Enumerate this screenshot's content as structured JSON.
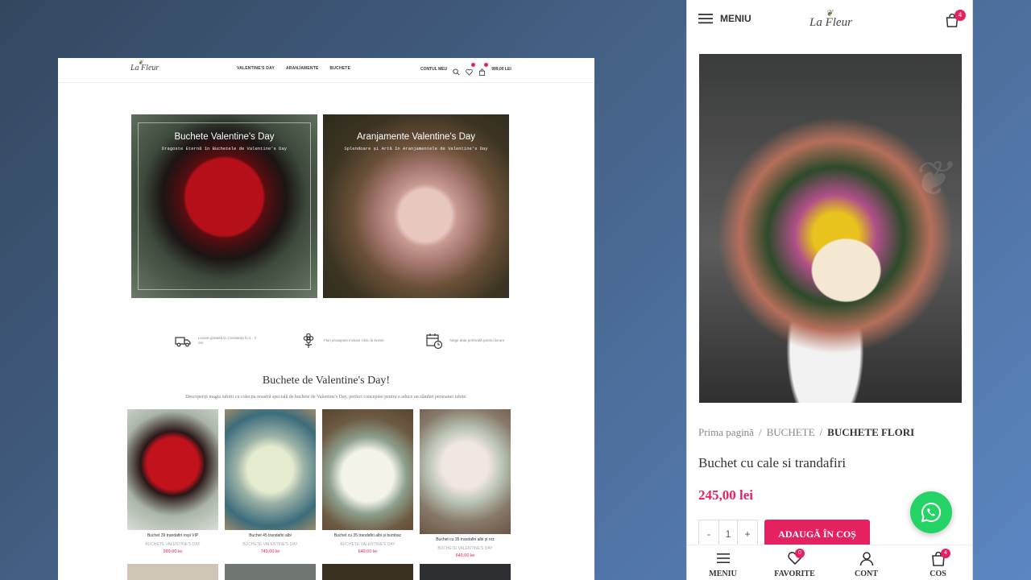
{
  "desktop": {
    "logo": "La Fleur",
    "nav": [
      "VALENTINE'S DAY",
      "ARANJAMENTE",
      "BUCHETE"
    ],
    "account": "CONTUL MEU",
    "wishlist_count": "",
    "cart_amount": "999,00 LEI",
    "banners": [
      {
        "title": "Buchete Valentine's Day",
        "subtitle": "Dragoste Eternă în Buchetele de Valentine's Day"
      },
      {
        "title": "Aranjamente Valentine's Day",
        "subtitle": "Splendoare și Artă în Aranjamentele de Valentine's Day"
      }
    ],
    "features": [
      {
        "icon": "delivery-truck-icon",
        "text": "Livrare gratuită în Constanța în 2 - 4 ore"
      },
      {
        "icon": "flower-icon",
        "text": "Flori proaspete incluse zilnic la livrare"
      },
      {
        "icon": "calendar-clock-icon",
        "text": "Alege data preferată pentru livrare"
      }
    ],
    "section_title": "Buchete de Valentine's Day!",
    "section_subtitle": "Descoperiți magia iubirii cu colecția noastră specială de buchete de Valentine's Day, perfect concepute pentru a aduce un zâmbet persoanei iubite.",
    "products": [
      {
        "name": "Buchet 39 trandafiri roșii VIP",
        "category": "BUCHETE VALENTINE'S DAY",
        "price": "999,00 lei"
      },
      {
        "name": "Buchet 45 trandafiri albi",
        "category": "BUCHETE VALENTINE'S DAY",
        "price": "749,00 lei"
      },
      {
        "name": "Buchet cu 35 trandafiri albi și bumbac",
        "category": "BUCHETE VALENTINE'S DAY",
        "price": "649,00 lei"
      },
      {
        "name": "Buchet cu 35 trandafiri albi și roz",
        "category": "BUCHETE VALENTINE'S DAY",
        "price": "649,00 lei"
      }
    ]
  },
  "mobile": {
    "menu_label": "MENIU",
    "logo": "La Fleur",
    "cart_badge": "4",
    "breadcrumb": {
      "home": "Prima pagină",
      "sep": "/",
      "cat": "BUCHETE",
      "current": "BUCHETE FLORI"
    },
    "product_title": "Buchet cu cale si trandafiri",
    "price": "245,00 lei",
    "qty_minus": "-",
    "qty_value": "1",
    "qty_plus": "+",
    "add_to_cart": "ADAUGĂ ÎN COȘ",
    "bottom_nav": [
      {
        "label": "MENIU",
        "icon": "hamburger-icon",
        "badge": ""
      },
      {
        "label": "FAVORITE",
        "icon": "heart-icon",
        "badge": "0"
      },
      {
        "label": "CONT",
        "icon": "user-icon",
        "badge": ""
      },
      {
        "label": "COS",
        "icon": "cart-icon",
        "badge": "4"
      }
    ]
  },
  "colors": {
    "accent": "#e6215f",
    "whatsapp": "#25d366"
  }
}
